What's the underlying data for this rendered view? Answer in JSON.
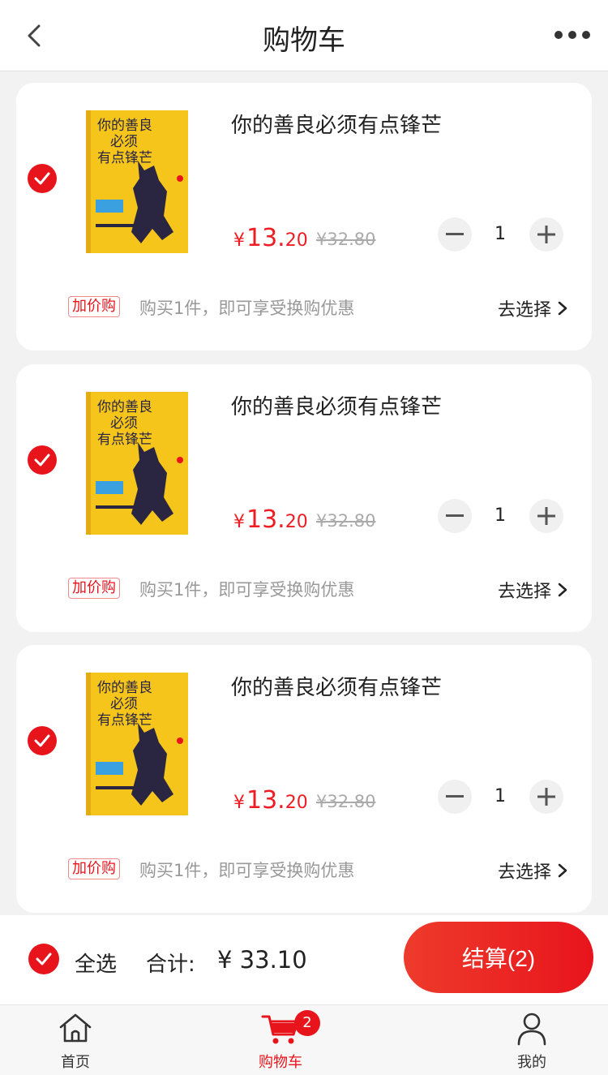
{
  "header": {
    "title": "购物车"
  },
  "cart_items": [
    {
      "title": "你的善良必须有点锋芒",
      "price_currency": "¥",
      "price_int": "13.",
      "price_dec": "20",
      "old_price": "¥32.80",
      "quantity": "1",
      "promo_badge": "加价购",
      "promo_text": "购买1件，即可享受换购优惠",
      "choose_label": "去选择",
      "cover_title": "你的善良必须有点锋芒",
      "selected": true
    },
    {
      "title": "你的善良必须有点锋芒",
      "price_currency": "¥",
      "price_int": "13.",
      "price_dec": "20",
      "old_price": "¥32.80",
      "quantity": "1",
      "promo_badge": "加价购",
      "promo_text": "购买1件，即可享受换购优惠",
      "choose_label": "去选择",
      "cover_title": "你的善良必须有点锋芒",
      "selected": true
    },
    {
      "title": "你的善良必须有点锋芒",
      "price_currency": "¥",
      "price_int": "13.",
      "price_dec": "20",
      "old_price": "¥32.80",
      "quantity": "1",
      "promo_badge": "加价购",
      "promo_text": "购买1件，即可享受换购优惠",
      "choose_label": "去选择",
      "cover_title": "你的善良必须有点锋芒",
      "selected": true
    }
  ],
  "summary": {
    "select_all_label": "全选",
    "total_label": "合计:",
    "total_value": "¥ 33.10",
    "checkout_label": "结算(2)"
  },
  "tabbar": {
    "tabs": [
      {
        "label": "首页",
        "icon": "home-icon"
      },
      {
        "label": "购物车",
        "icon": "cart-icon",
        "badge": "2",
        "active": true
      },
      {
        "label": "我的",
        "icon": "user-icon"
      }
    ]
  },
  "colors": {
    "accent": "#e8141c",
    "book_yellow": "#f5c51b",
    "cat_dark": "#2a2642"
  }
}
